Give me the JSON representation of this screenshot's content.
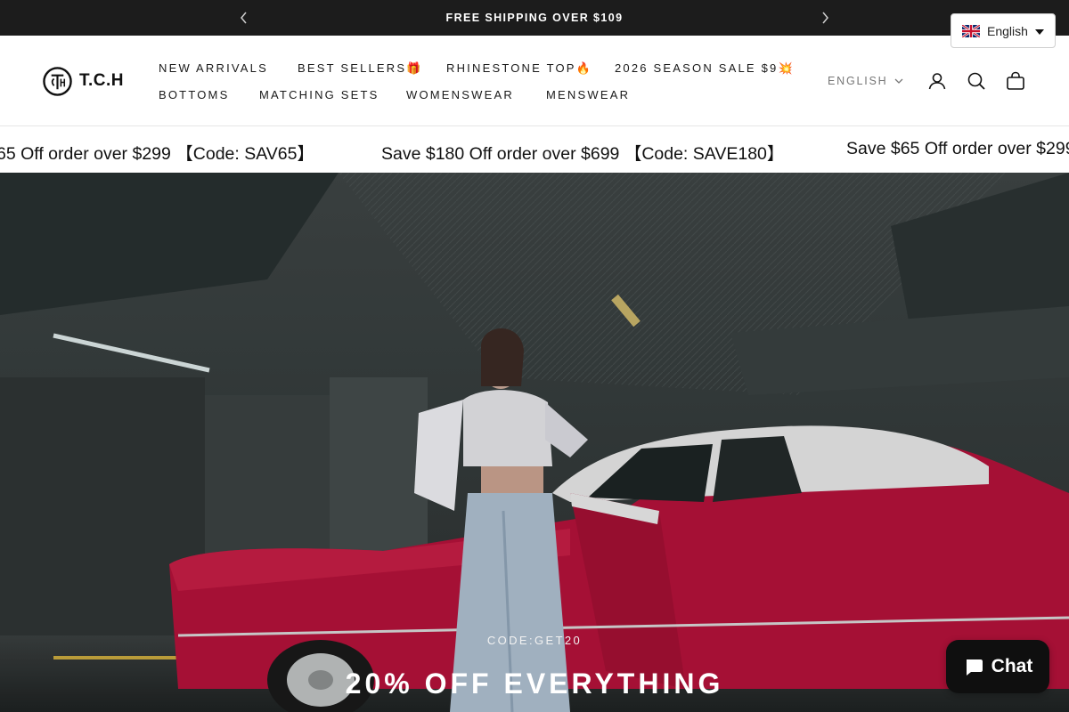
{
  "announcement": {
    "message": "FREE SHIPPING OVER $109",
    "prev_icon": "chevron-left-icon",
    "next_icon": "chevron-right-icon"
  },
  "language_widget": {
    "flag_icon": "uk-flag-icon",
    "label": "English"
  },
  "header": {
    "logo_text": "T.C.H",
    "nav_items": [
      "NEW ARRIVALS",
      "BEST SELLERS🎁",
      "RHINESTONE TOP🔥",
      "2026 SEASON SALE $9💥",
      "BOTTOMS",
      "MATCHING SETS",
      "WOMENSWEAR",
      "MENSWEAR"
    ],
    "language_select": "ENGLISH",
    "icons": [
      "account-icon",
      "search-icon",
      "cart-icon"
    ]
  },
  "ticker": {
    "items": [
      "65 Off order over $299 【Code: SAV65】",
      "Save $180 Off order over $699 【Code: SAVE180】",
      "Save $65 Off order over $299"
    ]
  },
  "hero": {
    "code": "CODE:GET20",
    "headline": "20% OFF EVERYTHING"
  },
  "chat": {
    "label": "Chat",
    "icon": "chat-bubble-icon"
  },
  "colors": {
    "announcement_bg": "#1c1c1c",
    "car_red": "#b3123a",
    "chat_bg": "#0f0f0f"
  }
}
